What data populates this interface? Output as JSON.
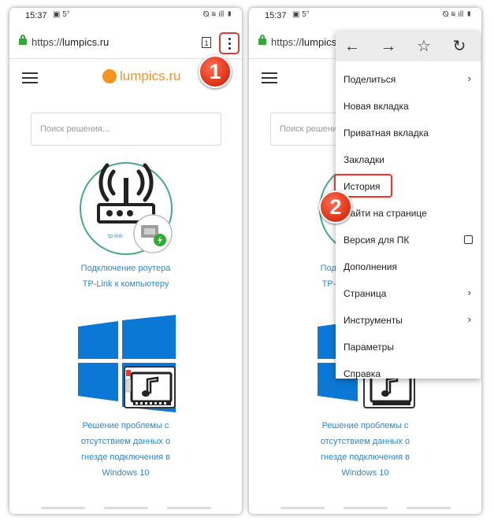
{
  "status_bar": {
    "time": "15:37",
    "temp": "5°",
    "icons_left": "▣ 5°",
    "icons_right": "⦰ ≋ ıll ▮"
  },
  "browser": {
    "url_prefix": "https://",
    "url_domain": "lumpics.ru",
    "url_domain_short": "lumpics",
    "tabs_count": "1"
  },
  "site": {
    "logo_text": "lumpics.ru",
    "search_placeholder": "Поиск решения...",
    "articles": [
      {
        "title_line1": "Подключение роутера",
        "title_line2": "TP-Link к компьютеру",
        "image_label": "tp-link"
      },
      {
        "title_line1": "Решение проблемы с",
        "title_line2": "отсутствием данных о",
        "title_line3": "гнезде подключения в",
        "title_line4": "Windows 10"
      }
    ]
  },
  "markers": {
    "step1": "1",
    "step2": "2"
  },
  "menu": {
    "nav": {
      "back": "←",
      "forward": "→",
      "bookmark": "☆",
      "reload": "↻"
    },
    "items": [
      {
        "label": "Поделиться",
        "type": "submenu"
      },
      {
        "label": "Новая вкладка",
        "type": "item"
      },
      {
        "label": "Приватная вкладка",
        "type": "item"
      },
      {
        "label": "Закладки",
        "type": "item"
      },
      {
        "label": "История",
        "type": "item",
        "highlighted": true
      },
      {
        "label": "Найти на странице",
        "type": "item"
      },
      {
        "label": "Версия для ПК",
        "type": "checkbox",
        "checked": false
      },
      {
        "label": "Дополнения",
        "type": "item"
      },
      {
        "label": "Страница",
        "type": "submenu"
      },
      {
        "label": "Инструменты",
        "type": "submenu"
      },
      {
        "label": "Параметры",
        "type": "item"
      },
      {
        "label": "Справка",
        "type": "item"
      }
    ],
    "chevron": "›"
  },
  "colors": {
    "accent": "#e53935",
    "brand": "#f7931e",
    "link": "#2f88c7",
    "windows_blue": "#0a78d4",
    "secure_green": "#2eaa2e"
  }
}
